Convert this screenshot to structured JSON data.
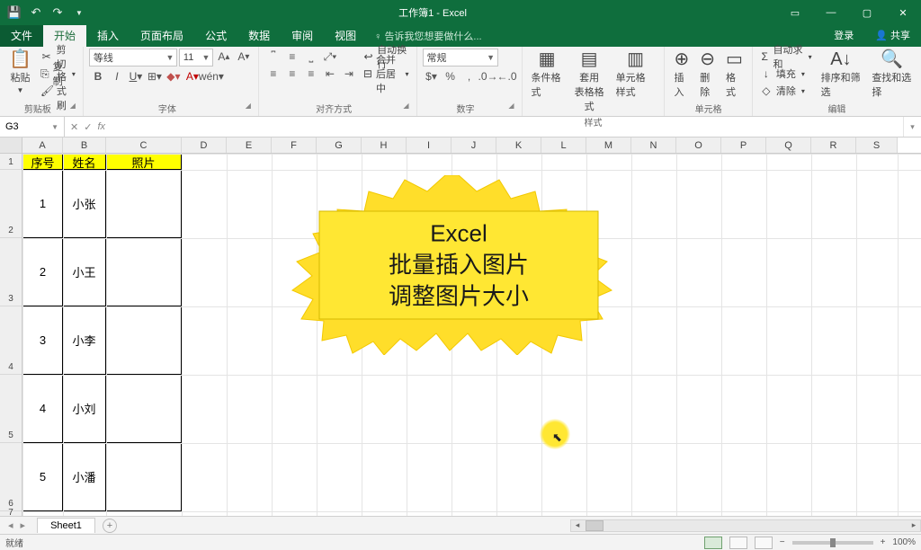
{
  "title": "工作簿1 - Excel",
  "menu": {
    "file": "文件",
    "tabs": [
      "开始",
      "插入",
      "页面布局",
      "公式",
      "数据",
      "审阅",
      "视图"
    ],
    "tell": "告诉我您想要做什么...",
    "login": "登录",
    "share": "共享"
  },
  "ribbon": {
    "clipboard": {
      "paste": "粘贴",
      "cut": "剪切",
      "copy": "复制",
      "format_painter": "格式刷",
      "label": "剪贴板"
    },
    "font": {
      "name": "等线",
      "size": "11",
      "label": "字体"
    },
    "align": {
      "wrap": "自动换行",
      "merge": "合并后居中",
      "label": "对齐方式"
    },
    "number": {
      "format": "常规",
      "label": "数字"
    },
    "styles": {
      "conditional": "条件格式",
      "as_table": "套用\n表格格式",
      "cell_styles": "单元格样式",
      "label": "样式"
    },
    "cells": {
      "insert": "插入",
      "delete": "删除",
      "format": "格式",
      "label": "单元格"
    },
    "editing": {
      "autosum": "自动求和",
      "fill": "填充",
      "clear": "清除",
      "sort": "排序和筛选",
      "find": "查找和选择",
      "label": "编辑"
    }
  },
  "namebox": "G3",
  "columns": [
    "A",
    "B",
    "C",
    "D",
    "E",
    "F",
    "G",
    "H",
    "I",
    "J",
    "K",
    "L",
    "M",
    "N",
    "O",
    "P",
    "Q",
    "R",
    "S"
  ],
  "rows": [
    "1",
    "2",
    "3",
    "4",
    "5",
    "6",
    "7"
  ],
  "headers": {
    "col1": "序号",
    "col2": "姓名",
    "col3": "照片"
  },
  "data": [
    {
      "no": "1",
      "name": "小张"
    },
    {
      "no": "2",
      "name": "小王"
    },
    {
      "no": "3",
      "name": "小李"
    },
    {
      "no": "4",
      "name": "小刘"
    },
    {
      "no": "5",
      "name": "小潘"
    }
  ],
  "callout": {
    "line1": "Excel",
    "line2": "批量插入图片",
    "line3": "调整图片大小"
  },
  "sheet_tab": "Sheet1",
  "status": "就绪",
  "zoom": "100%"
}
